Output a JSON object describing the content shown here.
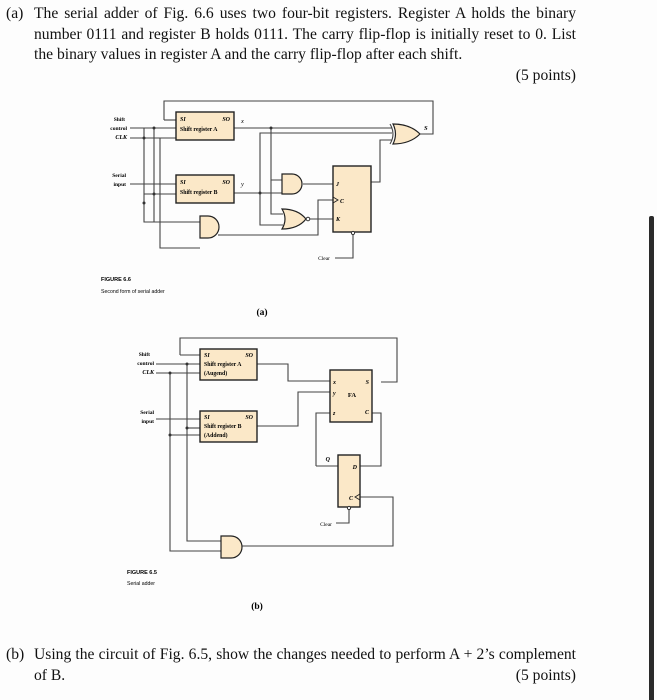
{
  "question_a": {
    "label": "(a)",
    "text": "The serial adder of Fig. 6.6 uses two four-bit registers. Register A holds the binary number 0111 and register B holds 0111. The carry flip-flop is initially reset to 0. List the binary values in register A and the carry flip-flop after each shift.",
    "points": "(5 points)"
  },
  "figure_a": {
    "shift_control": [
      "Shift",
      "control"
    ],
    "clk": "CLK",
    "serial_input": [
      "Serial",
      "input"
    ],
    "reg_a": {
      "si": "SI",
      "so": "SO",
      "name": "Shift register A",
      "out": "x"
    },
    "reg_b": {
      "si": "SI",
      "so": "SO",
      "name": "Shift register B",
      "out": "y"
    },
    "sum_out": "S",
    "jk": {
      "j": "J",
      "c": "C",
      "k": "K"
    },
    "clear": "Clear",
    "caption_title": "FIGURE 6.6",
    "caption_text": "Second form of serial adder",
    "sublabel": "(a)"
  },
  "figure_b": {
    "shift_control": [
      "Shift",
      "control"
    ],
    "clk": "CLK",
    "serial_input": [
      "Serial",
      "input"
    ],
    "reg_a": {
      "si": "SI",
      "so": "SO",
      "name": "Shift register A",
      "sub": "(Augend)"
    },
    "reg_b": {
      "si": "SI",
      "so": "SO",
      "name": "Shift register B",
      "sub": "(Addend)"
    },
    "fa": {
      "x": "x",
      "y": "y",
      "z": "z",
      "name": "FA",
      "s": "S",
      "c": "C"
    },
    "dff": {
      "q": "Q",
      "d": "D",
      "c": "C"
    },
    "clear": "Clear",
    "caption_title": "FIGURE 6.5",
    "caption_text": "Serial adder",
    "sublabel": "(b)"
  },
  "question_b": {
    "label": "(b)",
    "text": "Using the circuit of Fig. 6.5, show the changes needed to perform A + 2’s complement of B.",
    "points": "(5 points)"
  }
}
